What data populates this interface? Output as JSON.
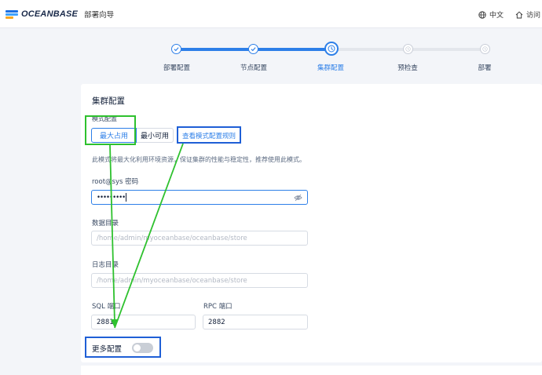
{
  "header": {
    "brand": "OCEANBASE",
    "app_name": "部署向导",
    "language": "中文",
    "visit": "访问"
  },
  "steps": [
    {
      "label": "部署配置",
      "state": "done"
    },
    {
      "label": "节点配置",
      "state": "done"
    },
    {
      "label": "集群配置",
      "state": "current"
    },
    {
      "label": "预检查",
      "state": "todo"
    },
    {
      "label": "部署",
      "state": "todo"
    }
  ],
  "cluster": {
    "title": "集群配置",
    "mode_label": "模式配置",
    "mode_options": [
      "最大占用",
      "最小可用"
    ],
    "selected_mode": "最大占用",
    "view_rules": "查看模式配置规则",
    "mode_note": "此模式将最大化利用环境资源，保证集群的性能与稳定性，推荐使用此模式。",
    "password_label": "root@sys 密码",
    "password_value": "•••••••••",
    "data_dir_label": "数据目录",
    "data_dir_placeholder": "/home/admin/myoceanbase/oceanbase/store",
    "log_dir_label": "日志目录",
    "log_dir_placeholder": "/home/admin/myoceanbase/oceanbase/store",
    "sql_port_label": "SQL 端口",
    "sql_port_value": "2881",
    "rpc_port_label": "RPC 端口",
    "rpc_port_value": "2882",
    "more_config_label": "更多配置",
    "more_config_enabled": false
  },
  "colors": {
    "accent": "#2d7fe8",
    "annotation_green": "#2ec12e",
    "annotation_blue": "#1f5fd6"
  }
}
